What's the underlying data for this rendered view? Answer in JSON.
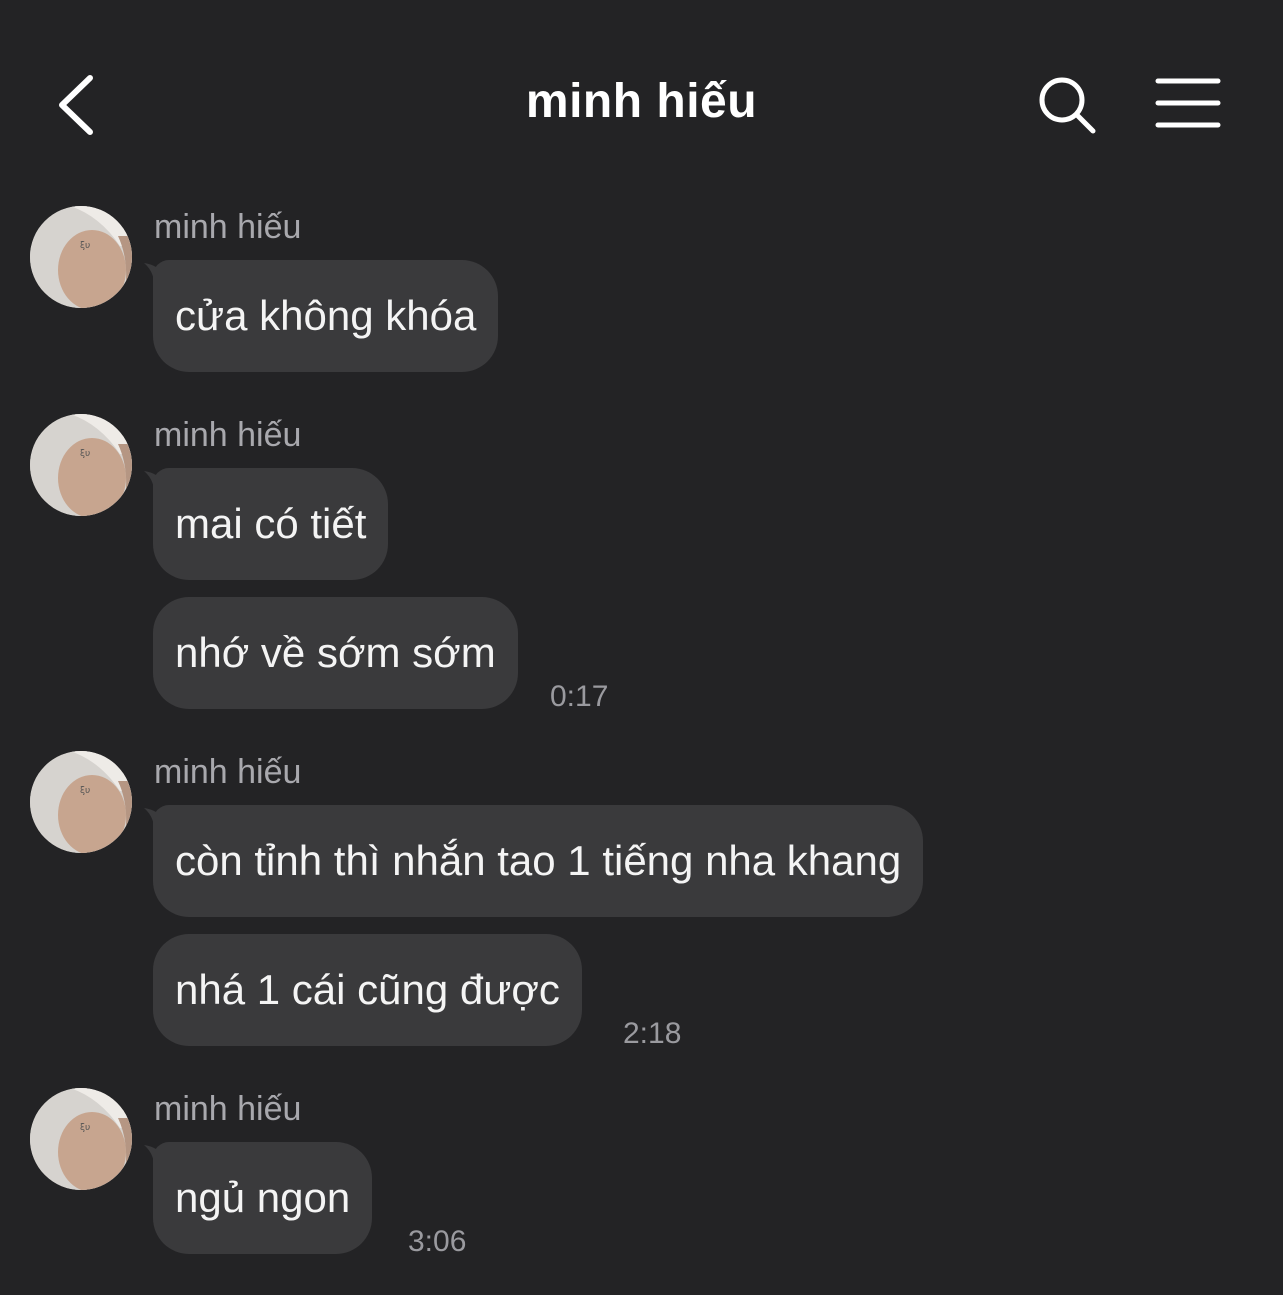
{
  "header": {
    "title": "minh hiếu",
    "back_icon": "chevron-left-icon",
    "search_icon": "search-icon",
    "menu_icon": "hamburger-menu-icon"
  },
  "colors": {
    "background": "#232325",
    "bubble": "#3a3a3c",
    "sender_name": "#a8a8ad",
    "timestamp": "#9a9a9f",
    "text": "#f4f4f4"
  },
  "messages": [
    {
      "sender": "minh hiếu",
      "bubbles": [
        "cửa không khóa"
      ],
      "time": ""
    },
    {
      "sender": "minh hiếu",
      "bubbles": [
        "mai có tiết",
        "nhớ về sớm sớm"
      ],
      "time": "0:17"
    },
    {
      "sender": "minh hiếu",
      "bubbles": [
        "còn tỉnh thì nhắn tao 1 tiếng nha khang",
        "nhá 1 cái cũng được"
      ],
      "time": "2:18"
    },
    {
      "sender": "minh hiếu",
      "bubbles": [
        "ngủ ngon"
      ],
      "time": "3:06"
    }
  ]
}
